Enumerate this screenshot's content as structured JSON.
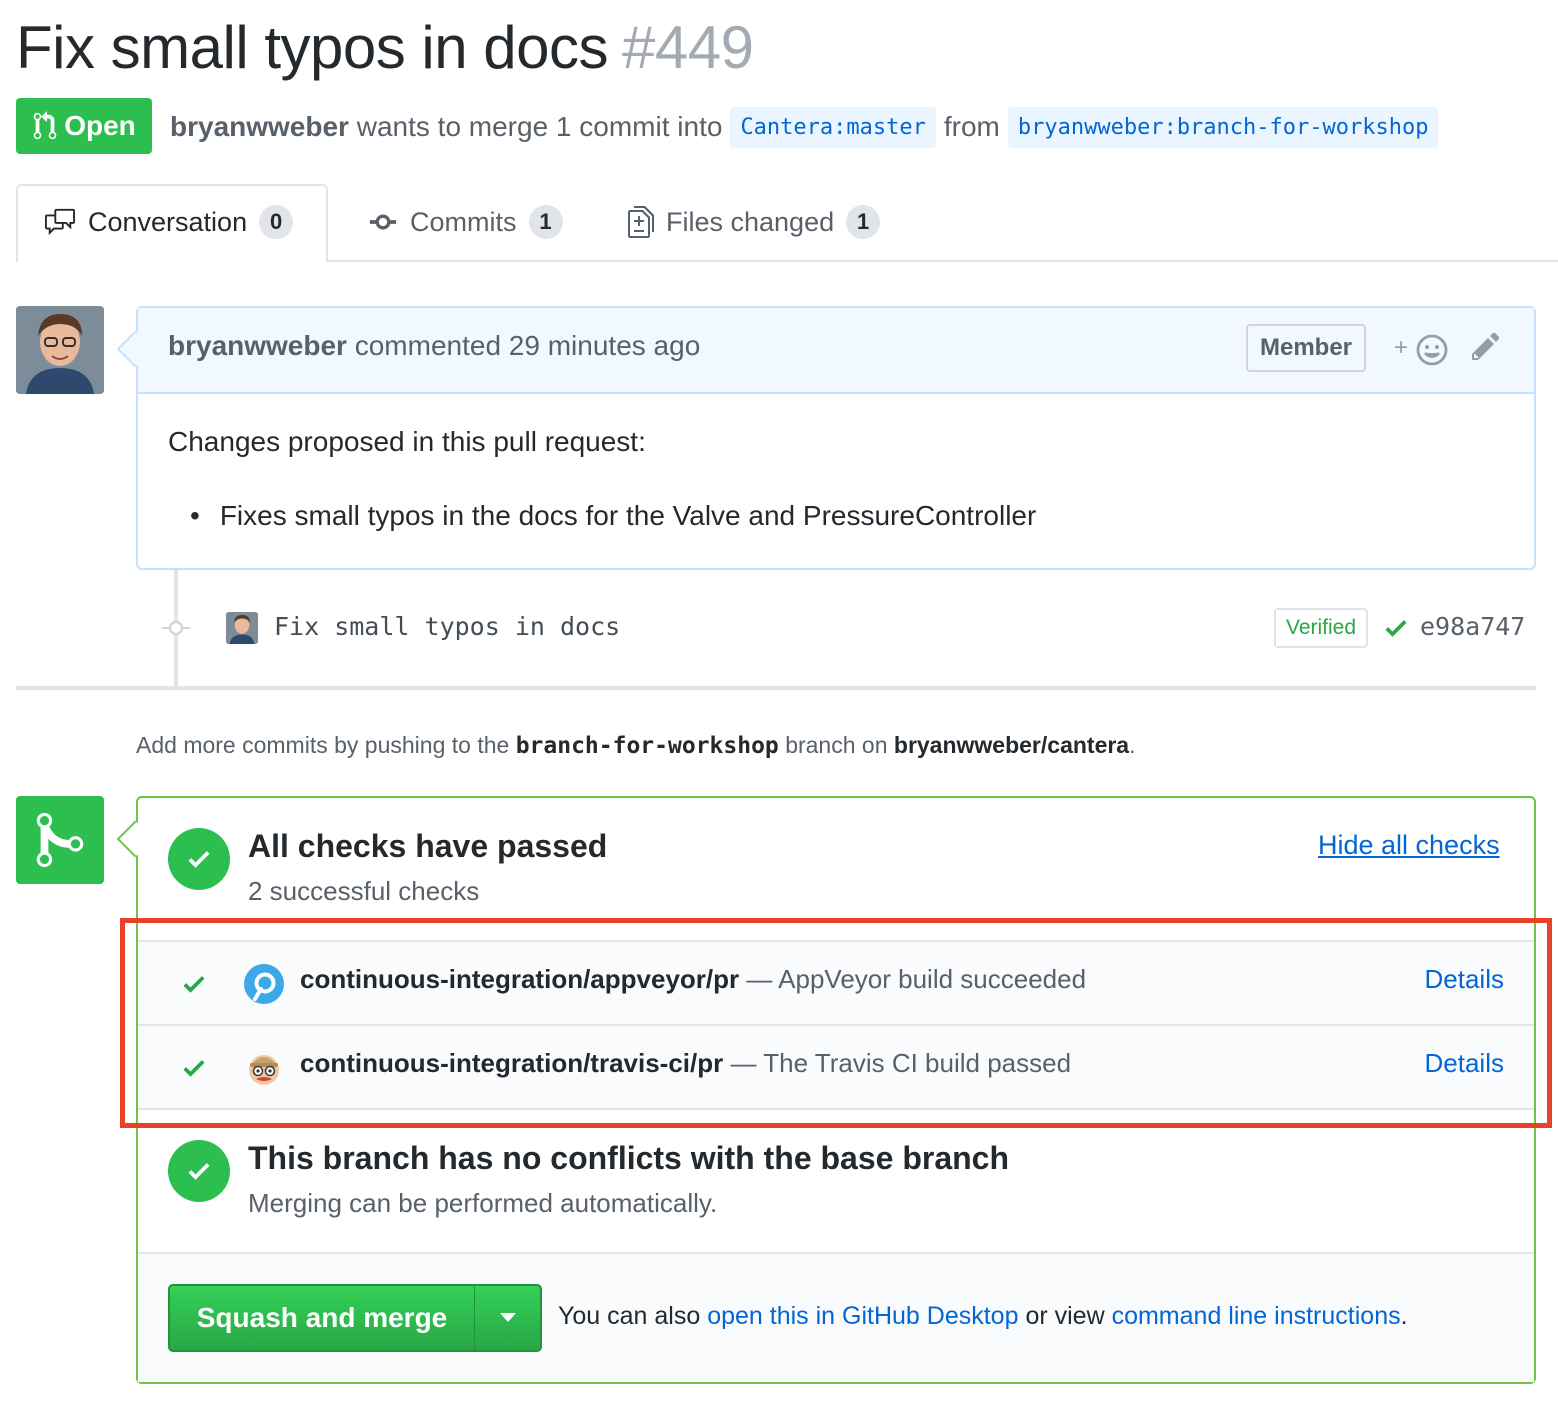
{
  "pr": {
    "title": "Fix small typos in docs",
    "number": "#449",
    "state": "Open",
    "author": "bryanwweber",
    "merge_text": "wants to merge 1 commit into",
    "base_ref": "Cantera:master",
    "from_text": "from",
    "head_ref": "bryanwweber:branch-for-workshop"
  },
  "tabs": [
    {
      "label": "Conversation",
      "count": "0",
      "icon": "comment-discussion-icon"
    },
    {
      "label": "Commits",
      "count": "1",
      "icon": "git-commit-icon"
    },
    {
      "label": "Files changed",
      "count": "1",
      "icon": "file-diff-icon"
    }
  ],
  "comment": {
    "author": "bryanwweber",
    "action": "commented 29 minutes ago",
    "role_badge": "Member",
    "reaction_plus": "+",
    "body_lead": "Changes proposed in this pull request:",
    "body_items": [
      "Fixes small typos in the docs for the Valve and PressureController"
    ]
  },
  "commit": {
    "message": "Fix small typos in docs",
    "verified": "Verified",
    "sha": "e98a747"
  },
  "push_hint": {
    "prefix": "Add more commits by pushing to the",
    "branch": "branch-for-workshop",
    "middle": "branch on",
    "repo": "bryanwweber/cantera",
    "suffix": "."
  },
  "checks": {
    "title": "All checks have passed",
    "subtitle": "2 successful checks",
    "hide_link": "Hide all checks",
    "items": [
      {
        "context": "continuous-integration/appveyor/pr",
        "description": "— AppVeyor build succeeded",
        "details": "Details",
        "logo": "appveyor-logo-icon"
      },
      {
        "context": "continuous-integration/travis-ci/pr",
        "description": "— The Travis CI build passed",
        "details": "Details",
        "logo": "travis-ci-logo-icon"
      }
    ]
  },
  "mergeability": {
    "title": "This branch has no conflicts with the base branch",
    "subtitle": "Merging can be performed automatically."
  },
  "merge_footer": {
    "button_label": "Squash and merge",
    "text_prefix": "You can also",
    "desktop_link": "open this in GitHub Desktop",
    "text_middle": "or view",
    "cli_link": "command line instructions",
    "text_suffix": "."
  },
  "colors": {
    "success_green": "#2cbe4e",
    "link_blue": "#0366d6",
    "highlight_red": "#e8412a"
  }
}
